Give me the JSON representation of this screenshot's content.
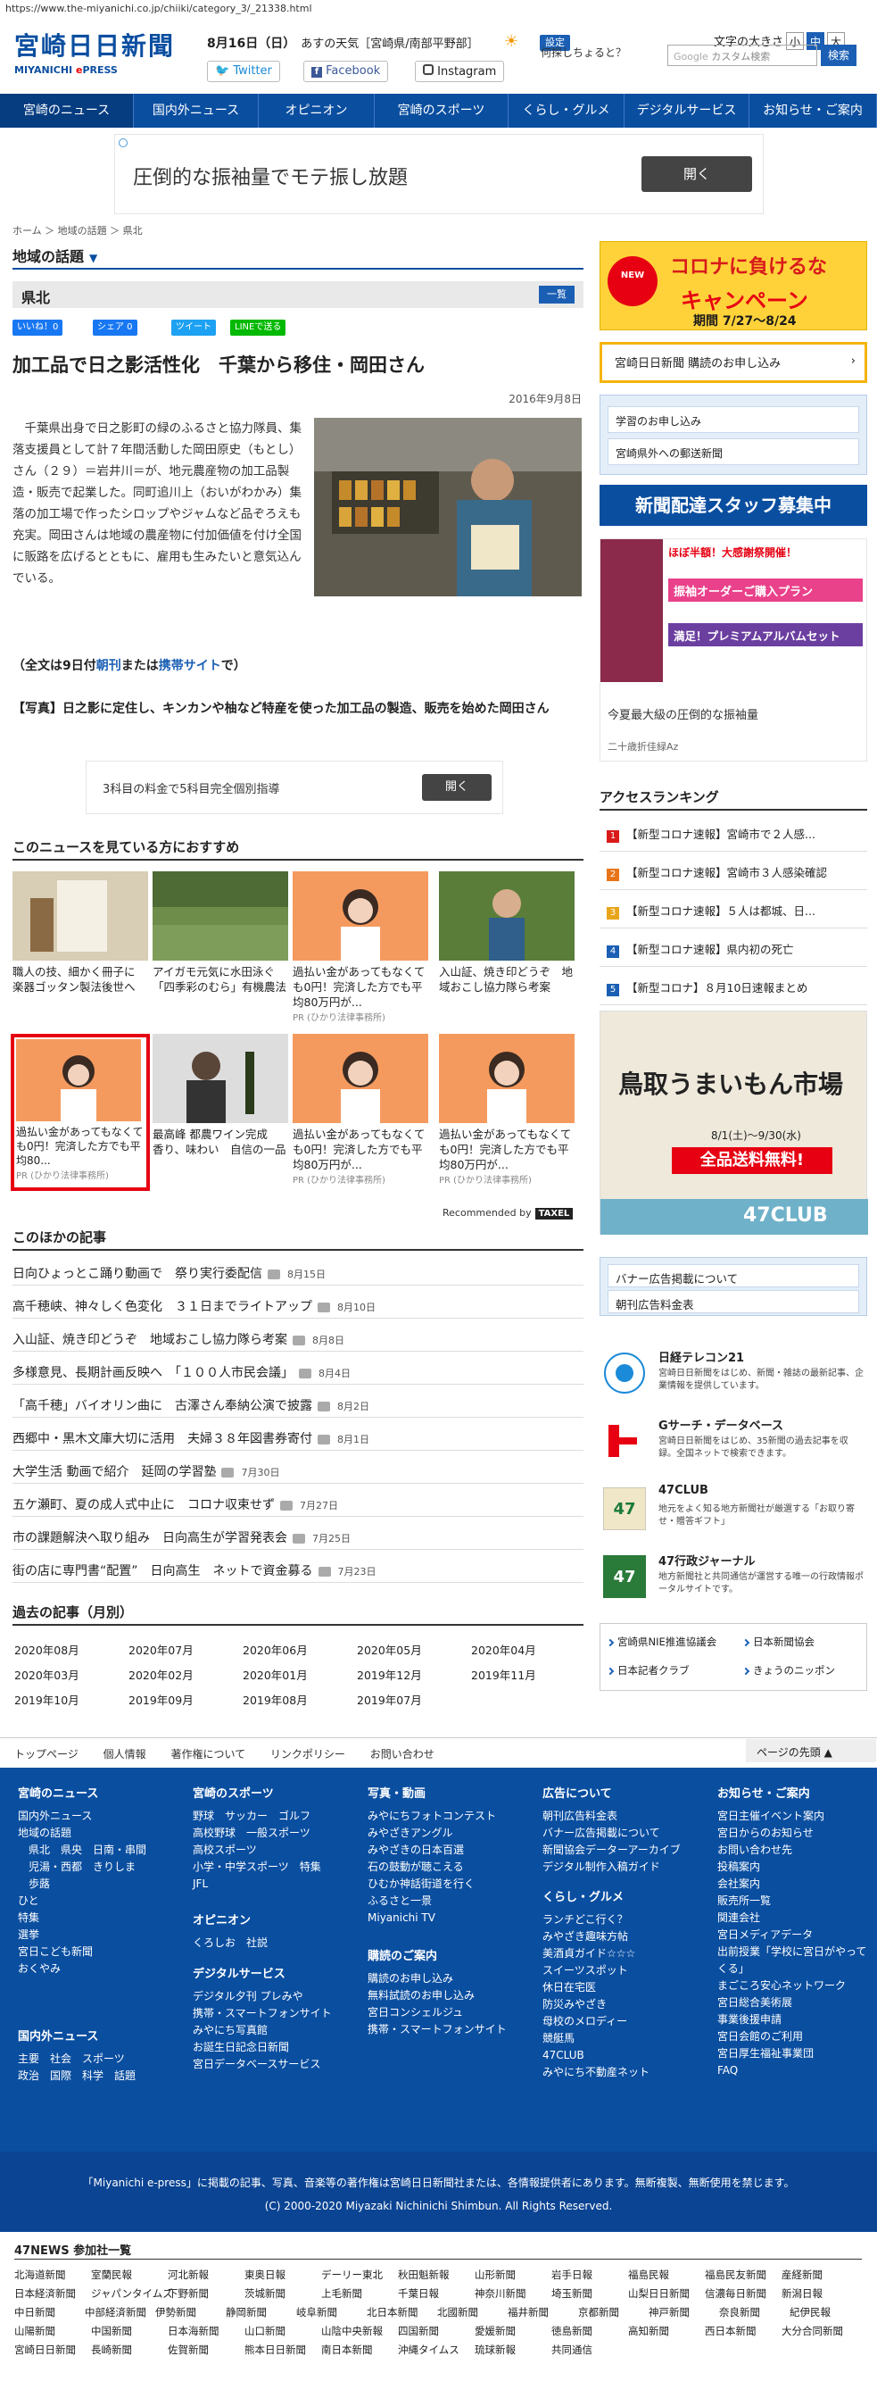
{
  "browser": {
    "url": "https://www.the-miyanichi.co.jp/chiiki/category_3/_21338.html"
  },
  "header": {
    "logo_main": "宮崎日日新聞",
    "logo_sub_a": "MIYANICHI ",
    "logo_sub_b": "e",
    "logo_sub_c": "PRESS",
    "date": "8月16日（日）",
    "weather": "あすの天気［宮崎県/南部平野部］",
    "settings": "設定",
    "twitter": "Twitter",
    "facebook": "Facebook",
    "instagram": "Instagram",
    "font_size_label": "文字の大きさ",
    "font_sizes": [
      "小",
      "中",
      "大"
    ],
    "question": "何探しちょると？",
    "search_placeholder": "カスタム検索",
    "search_button": "検索"
  },
  "nav": [
    "宮崎のニュース",
    "国内外ニュース",
    "オピニオン",
    "宮崎のスポーツ",
    "くらし・グルメ",
    "デジタルサービス",
    "お知らせ・ご案内"
  ],
  "ad_top": {
    "text": "圧倒的な振袖量でモテ振し放題",
    "button": "開く"
  },
  "breadcrumb": "ホーム ＞ 地域の話題 ＞ 県北",
  "section": {
    "title": "地域の話題",
    "sub": "県北",
    "list_button": "一覧"
  },
  "share": {
    "like": "いいね！0",
    "share": "シェア 0",
    "tweet": "ツイート",
    "line": "LINEで送る"
  },
  "article": {
    "title": "加工品で日之影活性化　千葉から移住・岡田さん",
    "date": "2016年9月8日",
    "body": "千葉県出身で日之影町の緑のふるさと協力隊員、集落支援員として計７年間活動した岡田原史（もとし）さん（２９）＝岩井川＝が、地元農産物の加工品製造・販売で起業した。同町追川上（おいがわかみ）集落の加工場で作ったシロップやジャムなど品ぞろえも充実。岡田さんは地域の農産物に付加価値を付け全国に販路を広げるとともに、雇用も生みたいと意気込んでいる。",
    "full_a": "（全文は9日付",
    "full_b": "朝刊",
    "full_c": "または",
    "full_d": "携帯サイト",
    "full_e": "で）",
    "caption": "【写真】日之影に定住し、キンカンや柚など特産を使った加工品の製造、販売を始めた岡田さん"
  },
  "ad_mid": {
    "text": "3科目の料金で5科目完全個別指導",
    "button": "開く"
  },
  "recommend": {
    "heading": "このニュースを見ている方におすすめ",
    "items": [
      {
        "text": "職人の技、細かく冊子に　楽器ゴッタン製法後世へ",
        "pr": ""
      },
      {
        "text": "アイガモ元気に水田泳ぐ 「四季彩のむら」有機農法",
        "pr": ""
      },
      {
        "text": "過払い金があってもなくても0円！完済した方でも平均80万円が...",
        "pr": "PR (ひかり法律事務所)"
      },
      {
        "text": "入山証、焼き印どうぞ　地域おこし協力隊ら考案",
        "pr": ""
      },
      {
        "text": "過払い金があってもなくても0円！完済した方でも平均80...",
        "pr": "PR (ひかり法律事務所)"
      },
      {
        "text": "最高峰 都農ワイン完成　香り、味わい　自信の一品",
        "pr": ""
      },
      {
        "text": "過払い金があってもなくても0円！完済した方でも平均80万円が...",
        "pr": "PR (ひかり法律事務所)"
      },
      {
        "text": "過払い金があってもなくても0円！完済した方でも平均80万円が...",
        "pr": "PR (ひかり法律事務所)"
      }
    ],
    "by": "Recommended by",
    "by_logo": "TAXEL"
  },
  "other": {
    "heading": "このほかの記事",
    "items": [
      {
        "title": "日向ひょっとこ踊り動画で　祭り実行委配信",
        "date": "8月15日"
      },
      {
        "title": "高千穂峡、神々しく色変化　３１日までライトアップ",
        "date": "8月10日"
      },
      {
        "title": "入山証、焼き印どうぞ　地域おこし協力隊ら考案",
        "date": "8月8日"
      },
      {
        "title": "多様意見、長期計画反映へ　「１００人市民会議」",
        "date": "8月4日"
      },
      {
        "title": "「高千穂」バイオリン曲に　古澤さん奉納公演で披露",
        "date": "8月2日"
      },
      {
        "title": "西郷中・黒木文庫大切に活用　夫婦３８年図書券寄付",
        "date": "8月1日"
      },
      {
        "title": "大学生活 動画で紹介　延岡の学習塾",
        "date": "7月30日"
      },
      {
        "title": "五ケ瀬町、夏の成人式中止に　コロナ収束せず",
        "date": "7月27日"
      },
      {
        "title": "市の課題解決へ取り組み　日向高生が学習発表会",
        "date": "7月25日"
      },
      {
        "title": "街の店に専門書“配置”　日向高生　ネットで資金募る",
        "date": "7月23日"
      }
    ]
  },
  "past": {
    "heading": "過去の記事（月別）",
    "months": [
      "2020年08月",
      "2020年07月",
      "2020年06月",
      "2020年05月",
      "2020年04月",
      "2020年03月",
      "2020年02月",
      "2020年01月",
      "2019年12月",
      "2019年11月",
      "2019年10月",
      "2019年09月",
      "2019年08月",
      "2019年07月"
    ]
  },
  "sidebar": {
    "campaign_a": "コロナに負けるな",
    "campaign_b": "キャンペーン",
    "campaign_c": "期間 7/27～8/24",
    "subscribe": "宮崎日日新聞 購読のお申し込み",
    "study": "学習のお申し込み",
    "mail": "宮崎県外への郵送新聞",
    "staff": "新聞配達スタッフ募集中",
    "ad3_a": "ほぼ半額！大感謝祭開催！",
    "ad3_b": "振袖オーダーご購入プラン",
    "ad3_c": "満足！プレミアムアルバムセット",
    "ad3_d": "今夏最大級の圧倒的な振袖量",
    "ad3_e": "二十歳折佳緑Az",
    "ranking_h": "アクセスランキング",
    "ranking": [
      "【新型コロナ速報】宮崎市で２人感...",
      "【新型コロナ速報】宮崎市３人感染確認",
      "【新型コロナ速報】５人は都城、日...",
      "【新型コロナ速報】県内初の死亡",
      "【新型コロナ】８月10日速報まとめ"
    ],
    "rank_colors": [
      "#d91a1a",
      "#e8751a",
      "#e8a51a",
      "#1b5fb4",
      "#1b5fb4"
    ],
    "tottori_a": "鳥取うまいもん市場",
    "tottori_b": "8/1(土)～9/30(水)",
    "tottori_c": "全品送料無料!",
    "tottori_d": "47CLUB",
    "banner_ad": "バナー広告掲載について",
    "ad_rates": "朝刊広告料金表",
    "services": [
      {
        "title": "日経テレコン21",
        "desc": "宮崎日日新聞をはじめ、新聞・雑誌の最新記事、企業情報を提供しています。"
      },
      {
        "title": "Gサーチ・データベース",
        "desc": "宮崎日日新聞をはじめ、35新聞の過去記事を収録。全国ネットで検索できます。"
      },
      {
        "title": "47CLUB",
        "desc": "地元をよく知る地方新聞社が厳選する「お取り寄せ・贈答ギフト」"
      },
      {
        "title": "47行政ジャーナル",
        "desc": "地方新聞社と共同通信が運営する唯一の行政情報ポータルサイトです。"
      }
    ],
    "links": [
      "宮崎県NIE推進協議会",
      "日本新聞協会",
      "日本記者クラブ",
      "きょうのニッポン"
    ]
  },
  "bottom_nav": [
    "トップページ",
    "個人情報",
    "著作権について",
    "リンクポリシー",
    "お問い合わせ"
  ],
  "page_top": "ページの先頭",
  "footer": {
    "cols": [
      {
        "h": "宮崎のニュース",
        "items": [
          "国内外ニュース",
          "地域の話題",
          "　県北　県央　日南・串間",
          "　児湯・西都　きりしま",
          "　歩蕗",
          "ひと",
          "特集",
          "選挙",
          "宮日こども新聞",
          "おくやみ"
        ]
      },
      {
        "h": "宮崎のスポーツ",
        "items": [
          "野球　サッカー　ゴルフ",
          "高校野球　一般スポーツ",
          "高校スポーツ",
          "小学・中学スポーツ　特集",
          "JFL"
        ]
      },
      {
        "h": "写真・動画",
        "items": [
          "みやにちフォトコンテスト",
          "みやざきアングル",
          "みやざきの日本百選",
          "石の鼓動が聴こえる",
          "ひむか神話街道を行く",
          "ふるさと一景",
          "Miyanichi TV"
        ]
      },
      {
        "h": "広告について",
        "items": [
          "朝刊広告料金表",
          "バナー広告掲載について",
          "新聞協会データーアーカイブ",
          "デジタル制作入稿ガイド"
        ]
      },
      {
        "h": "お知らせ・ご案内",
        "items": [
          "宮日主催イベント案内",
          "宮日からのお知らせ",
          "お問い合わせ先",
          "投稿案内",
          "会社案内",
          "販売所一覧",
          "関連会社",
          "宮日メディアデータ",
          "出前授業「学校に宮日がやってくる」",
          "まごころ安心ネットワーク",
          "宮日総合美術展",
          "事業後援申請",
          "宮日会館のご利用",
          "宮日厚生福祉事業団",
          "FAQ"
        ]
      }
    ],
    "col_opinion": {
      "h": "オピニオン",
      "items": [
        "くろしお　社説"
      ]
    },
    "col_digital": {
      "h": "デジタルサービス",
      "items": [
        "デジタル夕刊 プレみや",
        "携帯・スマートフォンサイト",
        "みやにち写真館",
        "お誕生日記念日新聞",
        "宮日データベースサービス"
      ]
    },
    "col_subscr": {
      "h": "購読のご案内",
      "items": [
        "購読のお申し込み",
        "無料試読のお申し込み",
        "宮日コンシェルジュ",
        "携帯・スマートフォンサイト"
      ]
    },
    "col_life": {
      "h": "くらし・グルメ",
      "items": [
        "ランチどこ行く？",
        "みやざき趣味方帖",
        "美酒貞ガイド☆☆☆",
        "スイーツスポット",
        "休日在宅医",
        "防災みやざき",
        "母校のメロディー",
        "競艇馬",
        "47CLUB",
        "みやにち不動産ネット"
      ]
    },
    "col_world": {
      "h": "国内外ニュース",
      "items": [
        "主要　社会　スポーツ",
        "政治　国際　科学　話題"
      ]
    }
  },
  "copyright": {
    "line1": "「Miyanichi e-press」に掲載の記事、写真、音楽等の著作権は宮崎日日新聞社または、各情報提供者にあります。無断複製、無断使用を禁じます。",
    "line2": "(C) 2000-2020 Miyazaki Nichinichi Shimbun. All Rights Reserved."
  },
  "news47": {
    "heading": "47NEWS 参加社一覧",
    "rows": [
      [
        "北海道新聞",
        "室蘭民報",
        "河北新報",
        "東奥日報",
        "デーリー東北",
        "秋田魁新報",
        "山形新聞",
        "岩手日報",
        "福島民報",
        "福島民友新聞",
        "産経新聞"
      ],
      [
        "日本経済新聞",
        "ジャパンタイムズ",
        "下野新聞",
        "茨城新聞",
        "上毛新聞",
        "千葉日報",
        "神奈川新聞",
        "埼玉新聞",
        "山梨日日新聞",
        "信濃毎日新聞",
        "新潟日報"
      ],
      [
        "中日新聞",
        "中部経済新聞",
        "伊勢新聞",
        "静岡新聞",
        "岐阜新聞",
        "北日本新聞",
        "北國新聞",
        "福井新聞",
        "京都新聞",
        "神戸新聞",
        "奈良新聞",
        "紀伊民報"
      ],
      [
        "山陽新聞",
        "中国新聞",
        "日本海新聞",
        "山口新聞",
        "山陰中央新報",
        "四国新聞",
        "愛媛新聞",
        "徳島新聞",
        "高知新聞",
        "西日本新聞",
        "大分合同新聞"
      ],
      [
        "宮崎日日新聞",
        "長崎新聞",
        "佐賀新聞",
        "熊本日日新聞",
        "南日本新聞",
        "沖縄タイムス",
        "琉球新報",
        "共同通信"
      ]
    ]
  }
}
